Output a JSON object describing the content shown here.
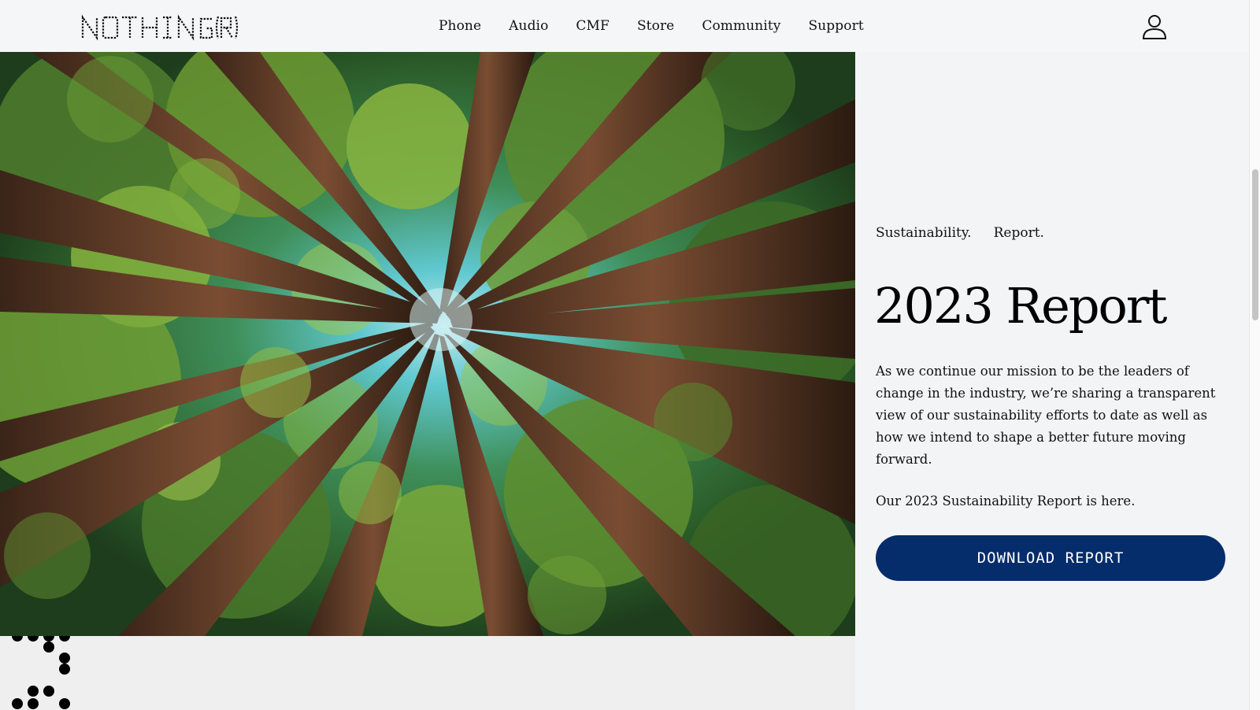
{
  "header": {
    "logo_text": "NOTHING (R)",
    "nav": [
      "Phone",
      "Audio",
      "CMF",
      "Store",
      "Community",
      "Support"
    ]
  },
  "hero": {
    "icon": "forest-canopy-image"
  },
  "panel": {
    "kicker": [
      "Sustainability.",
      "Report."
    ],
    "title": "2023 Report",
    "description": "As we continue our mission to be the leaders of change in the industry, we’re sharing a transparent view of our sustainability efforts to date as well as how we intend to shape a better future moving forward.",
    "note": "Our 2023 Sustainability Report is here.",
    "button_label": "DOWNLOAD REPORT"
  },
  "colors": {
    "button_bg": "#052c6b",
    "panel_bg": "#f3f4f5",
    "header_bg": "#f5f6f7"
  }
}
